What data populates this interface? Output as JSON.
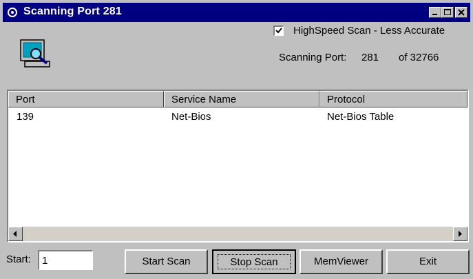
{
  "window": {
    "title": "Scanning Port  281",
    "controls": [
      "minimize-icon",
      "maximize-icon",
      "close-icon"
    ]
  },
  "options": {
    "highspeed_checked": true,
    "highspeed_label": "HighSpeed Scan - Less Accurate"
  },
  "status": {
    "scanning_label": "Scanning Port:",
    "current_port": "281",
    "of_text": "of 32766"
  },
  "table": {
    "columns": [
      "Port",
      "Service Name",
      "Protocol"
    ],
    "rows": [
      [
        "139",
        "Net-Bios",
        "Net-Bios Table"
      ]
    ]
  },
  "bottom": {
    "start_label": "Start:",
    "start_value": "1",
    "start_scan": "Start Scan",
    "stop_scan": "Stop Scan",
    "memviewer": "MemViewer",
    "exit": "Exit"
  },
  "colors": {
    "titlebar": "#000080",
    "face": "#c0c0c0"
  }
}
